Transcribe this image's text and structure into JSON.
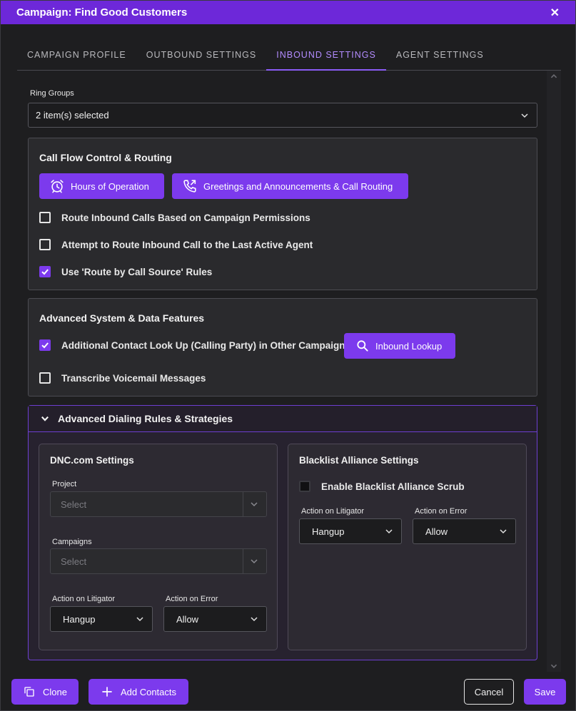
{
  "window": {
    "title": "Campaign: Find Good Customers",
    "close_glyph": "✕"
  },
  "tabs": [
    {
      "label": "CAMPAIGN PROFILE"
    },
    {
      "label": "OUTBOUND SETTINGS"
    },
    {
      "label": "INBOUND SETTINGS",
      "active": true
    },
    {
      "label": "AGENT SETTINGS"
    }
  ],
  "ring_groups": {
    "label": "Ring Groups",
    "value": "2 item(s) selected"
  },
  "call_flow": {
    "title": "Call Flow Control & Routing",
    "hours_button": "Hours of Operation",
    "greetings_button": "Greetings and Announcements & Call Routing",
    "options": [
      {
        "label": "Route Inbound Calls Based on Campaign Permissions",
        "checked": false
      },
      {
        "label": "Attempt to Route Inbound Call to the Last Active Agent",
        "checked": false
      },
      {
        "label": "Use 'Route by Call Source' Rules",
        "checked": true
      }
    ]
  },
  "advanced_features": {
    "title": "Advanced System & Data Features",
    "lookup_option": {
      "label": "Additional Contact Look Up (Calling Party) in Other Campaigns",
      "checked": true
    },
    "lookup_button": "Inbound Lookup",
    "voicemail_option": {
      "label": "Transcribe Voicemail Messages",
      "checked": false
    }
  },
  "advanced_dialing": {
    "title": "Advanced Dialing Rules & Strategies",
    "dnc": {
      "title": "DNC.com Settings",
      "project_label": "Project",
      "project_placeholder": "Select",
      "campaigns_label": "Campaigns",
      "campaigns_placeholder": "Select",
      "litigator_label": "Action on Litigator",
      "litigator_value": "Hangup",
      "error_label": "Action on Error",
      "error_value": "Allow"
    },
    "blacklist": {
      "title": "Blacklist Alliance Settings",
      "enable_label": "Enable Blacklist Alliance Scrub",
      "enable_checked": false,
      "litigator_label": "Action on Litigator",
      "litigator_value": "Hangup",
      "error_label": "Action on Error",
      "error_value": "Allow"
    }
  },
  "footer": {
    "clone": "Clone",
    "add_contacts": "Add Contacts",
    "cancel": "Cancel",
    "save": "Save"
  },
  "colors": {
    "accent": "#7c3aed",
    "titlebar": "#6d28d9",
    "active_tab": "#b38cff"
  }
}
